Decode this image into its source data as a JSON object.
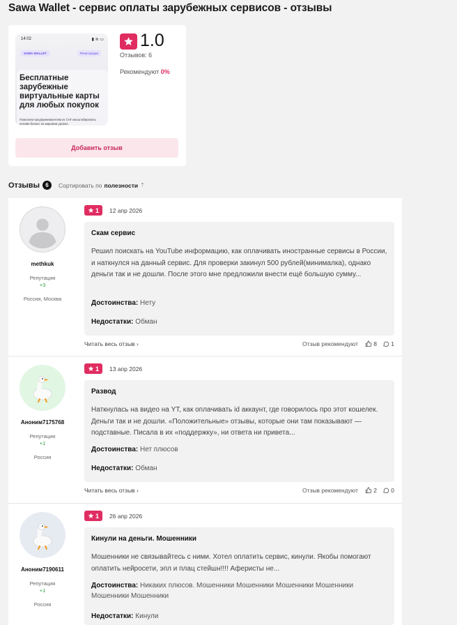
{
  "page": {
    "title": "Sawa Wallet - сервис оплаты зарубежных сервисов - отзывы"
  },
  "summary": {
    "promo": {
      "status_time": "14:02",
      "logo_text": "SAWA WALLET",
      "register_pill": "Регистрация",
      "headline": "Бесплатные зарубежные виртуальные карты для любых покупок",
      "subtext": "Помогаем предпринимателям из СНГ масштабировать онлайн-бизнес на мировом уровне."
    },
    "rating": "1.0",
    "reviews_count": "Отзывов: 6",
    "recommend_label": "Рекомендуют",
    "recommend_pct": "0%",
    "add_review_label": "Добавить отзыв",
    "accent_color": "#e02d61"
  },
  "reviews_header": {
    "title": "Отзывы",
    "count": "6",
    "sort_label": "Сортировать по",
    "sort_value": "полезности",
    "sort_arrow": "⇡"
  },
  "reviews": [
    {
      "user": "methkuk",
      "avatar_icon": "default-user-icon",
      "rep_label": "Репутация",
      "rep_value": "+3",
      "location": "Россия, Москва",
      "rating": "1",
      "date": "12 апр 2026",
      "title": "Скам сервис",
      "text": "Решил поискать на YouTube информацию, как оплачивать иностранные сервисы в России, и наткнулся на данный сервис. Для проверки закинул 500 рублей(минималка), однако деньги так и не дошли. После этого мне предложили внести ещё большую сумму...",
      "pros_label": "Достоинства:",
      "pros": "Нету",
      "cons_label": "Недостатки:",
      "cons": "Обман",
      "read_all": "Читать весь отзыв",
      "recommend_text": "Отзыв рекомендуют",
      "likes": "8",
      "comments": "1"
    },
    {
      "user": "Аноним7175768",
      "avatar_icon": "goose-icon",
      "rep_label": "Репутация",
      "rep_value": "+1",
      "location": "Россия",
      "rating": "1",
      "date": "13 апр 2026",
      "title": "Развод",
      "text": "Наткнулась на видео на YT, как оплачивать id аккаунт, где говорилось про этот кошелек. Деньги так и не дошли. «Положительные» отзывы, которые они там показывают — подставные. Писала в их «поддержку», ни ответа ни привета...",
      "pros_label": "Достоинства:",
      "pros": "Нет плюсов",
      "cons_label": "Недостатки:",
      "cons": "Обман",
      "read_all": "Читать весь отзыв",
      "recommend_text": "Отзыв рекомендуют",
      "likes": "2",
      "comments": "0"
    },
    {
      "user": "Аноним7190611",
      "avatar_icon": "goose-icon",
      "rep_label": "Репутация",
      "rep_value": "+1",
      "location": "Россия",
      "rating": "1",
      "date": "26 апр 2026",
      "title": "Кинули на деньги. Мошенники",
      "text": "Мошенники не связывайтесь с ними. Хотел оплатить сервис, кинули. Якобы помогают оплатить нейросети, эпл и плац стейшн!!!! Аферисты не...",
      "pros_label": "Достоинства:",
      "pros": "Никаких плюсов. Мошенники Мошенники Мошенники Мошенники Мошенники Мошенники",
      "cons_label": "Недостатки:",
      "cons": "Кинули"
    }
  ]
}
